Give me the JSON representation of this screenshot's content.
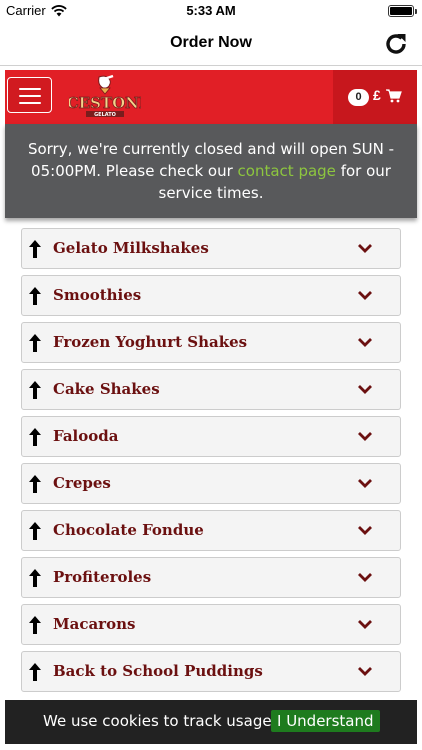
{
  "status_bar": {
    "carrier": "Carrier",
    "time": "5:33 AM"
  },
  "nav": {
    "title": "Order Now"
  },
  "header": {
    "logo_text": "ICESTONE",
    "logo_subtext": "GELATO",
    "cart_count": "0",
    "cart_currency": "£"
  },
  "notice": {
    "text_before": "Sorry, we're currently closed and will open SUN - 05:00PM. Please check our ",
    "link": "contact page",
    "text_after": " for our service times."
  },
  "categories": [
    {
      "label": "Gelato Milkshakes"
    },
    {
      "label": "Smoothies"
    },
    {
      "label": "Frozen Yoghurt Shakes"
    },
    {
      "label": "Cake Shakes"
    },
    {
      "label": "Falooda"
    },
    {
      "label": "Crepes"
    },
    {
      "label": "Chocolate Fondue"
    },
    {
      "label": "Profiteroles"
    },
    {
      "label": "Macarons"
    },
    {
      "label": "Back to School Puddings"
    }
  ],
  "cookie": {
    "text": "We use cookies to track usage.",
    "button": "I Understand"
  },
  "colors": {
    "brand_red": "#e11f26",
    "notice_gray": "#58595b",
    "link_green": "#8dc63f",
    "category_text": "#6b1010",
    "cookie_button": "#1e7b1e"
  }
}
